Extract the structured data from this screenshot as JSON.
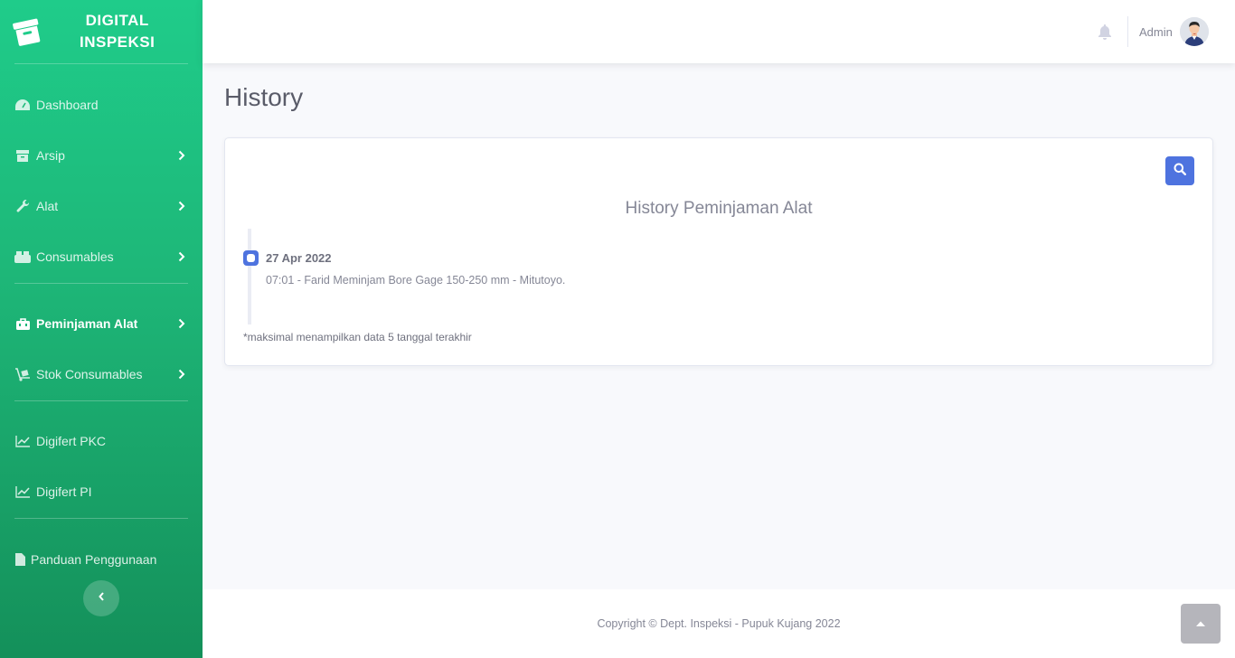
{
  "brand": {
    "line1": "DIGITAL",
    "line2": "INSPEKSI",
    "icon": "archive-box-icon"
  },
  "sidebar": {
    "items": [
      {
        "label": "Dashboard",
        "icon": "tachometer-icon"
      },
      {
        "label": "Arsip",
        "icon": "archive-icon"
      },
      {
        "label": "Alat",
        "icon": "wrench-icon"
      },
      {
        "label": "Consumables",
        "icon": "boxes-icon"
      },
      {
        "label": "Peminjaman Alat",
        "icon": "toolbox-icon"
      },
      {
        "label": "Stok Consumables",
        "icon": "dolly-icon"
      },
      {
        "label": "Digifert PKC",
        "icon": "chart-line-icon"
      },
      {
        "label": "Digifert PI",
        "icon": "chart-line-icon"
      },
      {
        "label": "Panduan Penggunaan",
        "icon": "file-icon"
      }
    ]
  },
  "topbar": {
    "user_name": "Admin"
  },
  "page": {
    "title": "History"
  },
  "card": {
    "title": "History Peminjaman Alat",
    "timeline": [
      {
        "date": "27 Apr 2022",
        "text": "07:01 - Farid Meminjam Bore Gage 150-250 mm - Mitutoyo."
      }
    ],
    "note": "*maksimal menampilkan data 5 tanggal terakhir"
  },
  "footer": {
    "copyright": "Copyright © Dept. Inspeksi - Pupuk Kujang 2022"
  },
  "colors": {
    "sidebar_top": "#1fcc8a",
    "sidebar_bottom": "#14905a",
    "primary": "#4e73df"
  }
}
